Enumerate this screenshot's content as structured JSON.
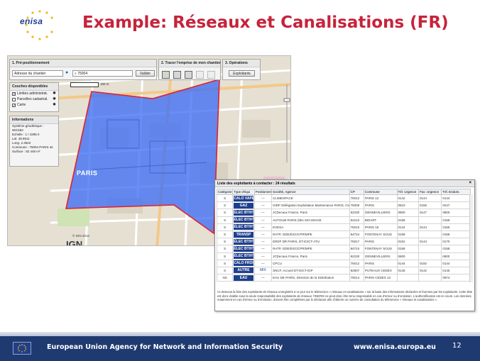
{
  "header": {
    "logo_text": "enisa",
    "title": "Example: Réseaux et Canalisations (FR)"
  },
  "app": {
    "step1": {
      "title": "1. Pré-positionnement",
      "select_value": "Adresse du chantier",
      "search_value": "75004",
      "validate_label": "Valider"
    },
    "step2": {
      "title": "2. Tracer l'emprise de mon chantier"
    },
    "step3": {
      "title": "3. Opérations",
      "button_label": "Exploitants"
    },
    "layers": {
      "title": "Couches disponibles",
      "items": [
        {
          "label": "Limites administrat.",
          "checked": "✓"
        },
        {
          "label": "Parcelles cadastral.",
          "checked": ""
        },
        {
          "label": "Carte",
          "checked": "✓"
        }
      ]
    },
    "info": {
      "title": "Informations",
      "lines": [
        "Système géodésique :",
        "WGS84",
        "Echelle : 1 / 4295 è",
        "Lat. 48.8611",
        "Long. 2.3522",
        "Commune : 75004 PARIS 4e",
        "Surface : 82 449 m²"
      ]
    },
    "map": {
      "scale_label": "100 m",
      "city_label": "PARIS",
      "provider": "IGN",
      "copyright": "© IGN 2014"
    }
  },
  "results": {
    "title": "Liste des exploitants à contacter : 24 résultats",
    "close": "×",
    "columns": [
      "Catégorie",
      "Type d'équi",
      "Positionnement",
      "Société, Agence",
      "CP",
      "Commune",
      "Tél. Urgence",
      "Fax. Urgence",
      "Tél. Endom."
    ],
    "rows": [
      {
        "cat": "S",
        "type": "CALO VAPEUR",
        "pos": "—",
        "agence": "CLIMESPACE",
        "cp": "75012",
        "commune": "PARIS 12",
        "tel": "0142",
        "fax": "0144",
        "endom": "0144"
      },
      {
        "cat": "S",
        "type": "GAZ",
        "pos": "—",
        "agence": "GrDF Délégation Exploitation Maintenance PARIS, Cellule T",
        "cp": "75009",
        "commune": "PARIS",
        "tel": "0810",
        "fax": "0155",
        "endom": "0247"
      },
      {
        "cat": "S",
        "type": "ÉLEC BT/HTA",
        "pos": "—",
        "agence": "JCDecaux France, Paris",
        "cp": "92230",
        "commune": "GENNEVILLIERS",
        "tel": "0800",
        "fax": "0147",
        "endom": "0800"
      },
      {
        "cat": "S",
        "type": "ÉLEC BT/HTA",
        "pos": "—",
        "agence": "AUTOLIB PARIS (Ifes SIG-IMAGE",
        "cp": "94210",
        "commune": "BIDART",
        "tel": "0158",
        "fax": "",
        "endom": "0158"
      },
      {
        "cat": "S",
        "type": "ÉLEC BT/HTA",
        "pos": "—",
        "agence": "EVESA",
        "cp": "75015",
        "commune": "PARIS 15",
        "tel": "0144",
        "fax": "0144",
        "endom": "0155"
      },
      {
        "cat": "S",
        "type": "TRANSP",
        "pos": "—",
        "agence": "RATP, GDE/ESC/CPR/MPE",
        "cp": "94724",
        "commune": "FONTENAY SOUS",
        "tel": "0158",
        "fax": "",
        "endom": "0158"
      },
      {
        "cat": "S",
        "type": "ÉLEC BT/HTA",
        "pos": "—",
        "agence": "ERDF DR PARIS, DT-EXCT-ATU",
        "cp": "75017",
        "commune": "PARIS",
        "tel": "0181",
        "fax": "0144",
        "endom": "0170"
      },
      {
        "cat": "S",
        "type": "ÉLEC BT/HTA",
        "pos": "—",
        "agence": "RATP, GDE/ESC/CPR/MPE",
        "cp": "94724",
        "commune": "FONTENAY SOUS",
        "tel": "0158",
        "fax": "",
        "endom": "0158"
      },
      {
        "cat": "S",
        "type": "ÉLEC BT/HTA",
        "pos": "—",
        "agence": "JCDecaux France, Paris",
        "cp": "92230",
        "commune": "GENNEVILLIERS",
        "tel": "0800",
        "fax": "",
        "endom": "0800"
      },
      {
        "cat": "S",
        "type": "CALO FROID",
        "pos": "—",
        "agence": "CPCU",
        "cp": "75012",
        "commune": "PARIS",
        "tel": "0144",
        "fax": "0192",
        "endom": "0144"
      },
      {
        "cat": "S",
        "type": "AUTRE",
        "pos": "MIX",
        "agence": "SNCF, Accueil DT-DICT-IGP",
        "cp": "92807",
        "commune": "PUTEAUX CEDEX",
        "tel": "0145",
        "fax": "0142",
        "endom": "0145"
      },
      {
        "cat": "NS",
        "type": "EAU",
        "pos": "—",
        "agence": "EAU DE PARIS, Direction de la Distribution",
        "cp": "75014",
        "commune": "PARIS CEDEX 13",
        "tel": "",
        "fax": "",
        "endom": "0974"
      }
    ],
    "note": "Ci-dessous la liste des exploitants de réseaux enregistrés à ce jour sur le téléservice « réseaux et canalisations » sur la base des informations déclarées et fournies par les exploitants. Cette liste est donc établie sous la seule responsabilité des exploitants de réseaux. l'INERIS ne peut donc être tenu responsable en cas d'erreur ou d'omission. L'authentification est en cours. Les données, notamment en cas d'erreur ou d'omission, doivent être complétées par le déclarant afin d'obtenir un numéro de consultation du téléservice « réseaux et canalisations »."
  },
  "footer": {
    "agency": "European Union Agency for Network and Information Security",
    "url": "www.enisa.europa.eu",
    "page": "12"
  },
  "colors": {
    "title": "#c6233b",
    "footer": "#1f3a70",
    "badge": "#1e3f8f",
    "polygon_fill": "#3d6ef5",
    "polygon_stroke": "#e0202e"
  }
}
